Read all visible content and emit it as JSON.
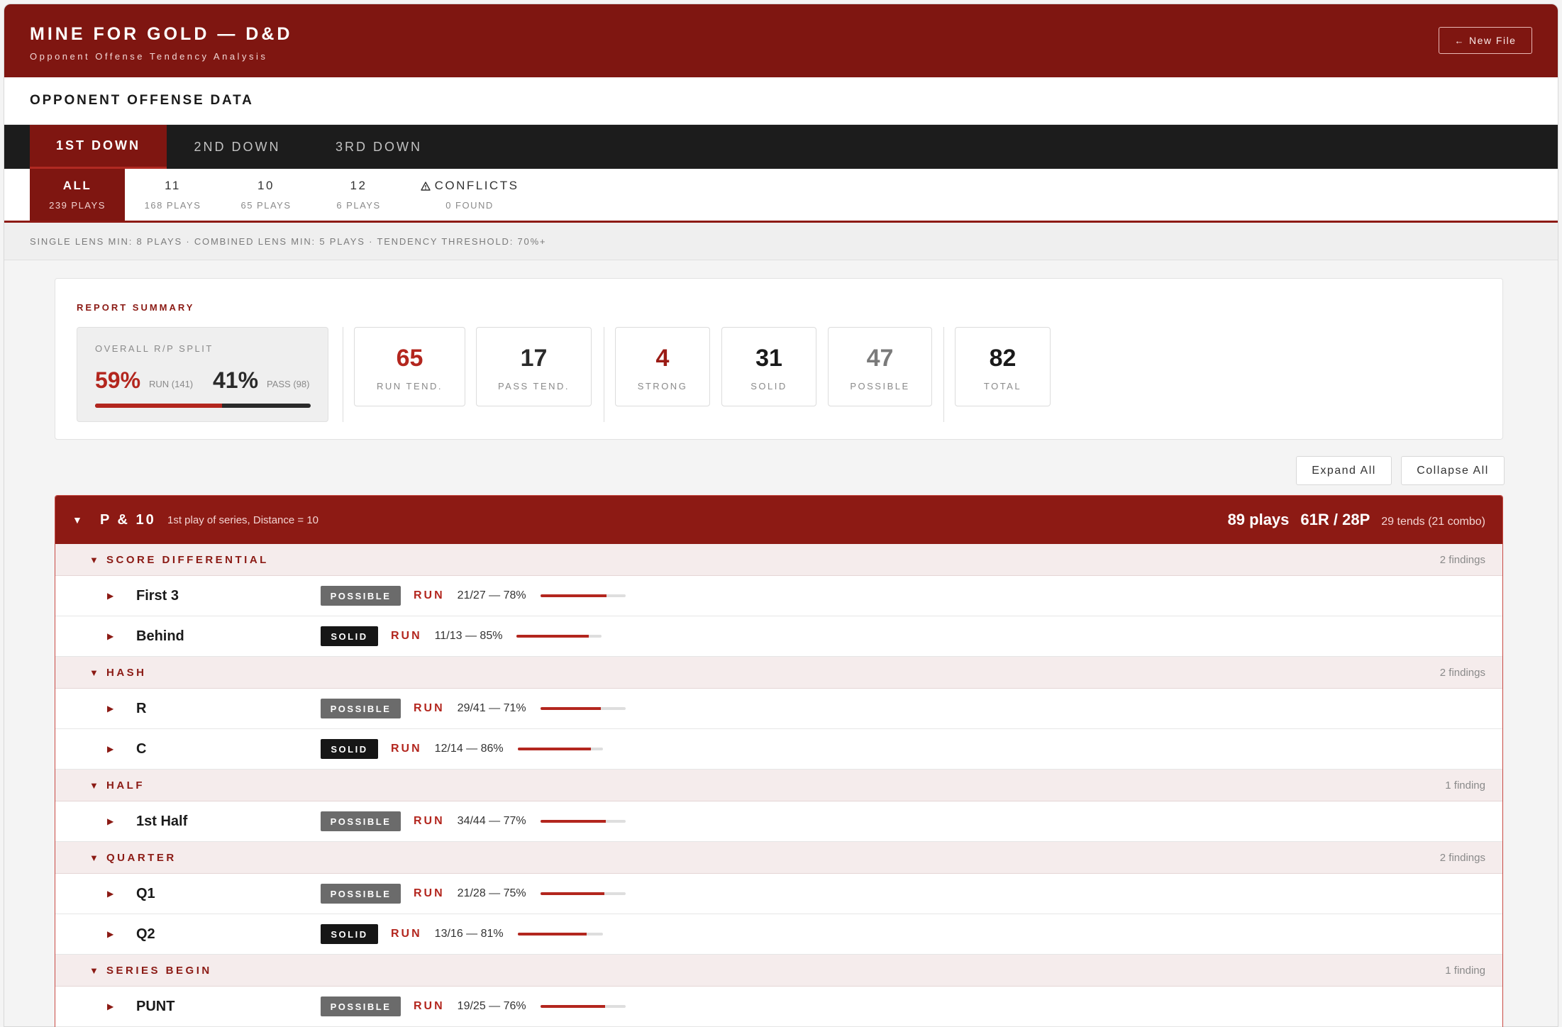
{
  "app": {
    "title": "MINE FOR GOLD — D&D",
    "subtitle": "Opponent Offense Tendency Analysis",
    "new_file": "New File"
  },
  "section_title": "OPPONENT OFFENSE DATA",
  "down_tabs": [
    "1ST DOWN",
    "2ND DOWN",
    "3RD DOWN"
  ],
  "formation_tabs": [
    {
      "label": "ALL",
      "count": "239 PLAYS"
    },
    {
      "label": "11",
      "count": "168 PLAYS"
    },
    {
      "label": "10",
      "count": "65 PLAYS"
    },
    {
      "label": "12",
      "count": "6 PLAYS"
    },
    {
      "label": "CONFLICTS",
      "count": "0 FOUND"
    }
  ],
  "thresholds": "SINGLE LENS MIN: 8 PLAYS · COMBINED LENS MIN: 5 PLAYS · TENDENCY THRESHOLD: 70%+",
  "summary": {
    "title": "REPORT SUMMARY",
    "split_label": "OVERALL R/P SPLIT",
    "run_pct": "59%",
    "run_label": "RUN (141)",
    "pass_pct": "41%",
    "pass_label": "PASS (98)",
    "run_fraction": 0.59,
    "stats": [
      {
        "num": "65",
        "label": "RUN TEND.",
        "color": "#b3261e"
      },
      {
        "num": "17",
        "label": "PASS TEND.",
        "color": "#2a2a2a"
      },
      {
        "num": "4",
        "label": "STRONG",
        "color": "#9b1b15"
      },
      {
        "num": "31",
        "label": "SOLID",
        "color": "#1a1a1a"
      },
      {
        "num": "47",
        "label": "POSSIBLE",
        "color": "#7a7a7a"
      },
      {
        "num": "82",
        "label": "TOTAL",
        "color": "#1a1a1a"
      }
    ]
  },
  "controls": {
    "expand": "Expand All",
    "collapse": "Collapse All"
  },
  "group": {
    "name": "P & 10",
    "desc": "1st play of series, Distance = 10",
    "plays": "89 plays",
    "rp": "61R / 28P",
    "tends": "29 tends (21 combo)"
  },
  "lenses": [
    {
      "name": "SCORE DIFFERENTIAL",
      "count": "2 findings",
      "findings": [
        {
          "name": "First 3",
          "badge": "POSSIBLE",
          "dir": "RUN",
          "ratio": "21/27 — 78%",
          "pct": 0.78
        },
        {
          "name": "Behind",
          "badge": "SOLID",
          "dir": "RUN",
          "ratio": "11/13 — 85%",
          "pct": 0.85
        }
      ]
    },
    {
      "name": "HASH",
      "count": "2 findings",
      "findings": [
        {
          "name": "R",
          "badge": "POSSIBLE",
          "dir": "RUN",
          "ratio": "29/41 — 71%",
          "pct": 0.71
        },
        {
          "name": "C",
          "badge": "SOLID",
          "dir": "RUN",
          "ratio": "12/14 — 86%",
          "pct": 0.86
        }
      ]
    },
    {
      "name": "HALF",
      "count": "1 finding",
      "findings": [
        {
          "name": "1st Half",
          "badge": "POSSIBLE",
          "dir": "RUN",
          "ratio": "34/44 — 77%",
          "pct": 0.77
        }
      ]
    },
    {
      "name": "QUARTER",
      "count": "2 findings",
      "findings": [
        {
          "name": "Q1",
          "badge": "POSSIBLE",
          "dir": "RUN",
          "ratio": "21/28 — 75%",
          "pct": 0.75
        },
        {
          "name": "Q2",
          "badge": "SOLID",
          "dir": "RUN",
          "ratio": "13/16 — 81%",
          "pct": 0.81
        }
      ]
    },
    {
      "name": "SERIES BEGIN",
      "count": "1 finding",
      "findings": [
        {
          "name": "PUNT",
          "badge": "POSSIBLE",
          "dir": "RUN",
          "ratio": "19/25 — 76%",
          "pct": 0.76
        }
      ]
    }
  ]
}
